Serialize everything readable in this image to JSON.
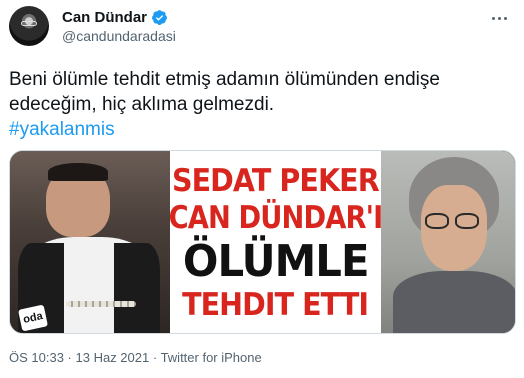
{
  "author": {
    "display_name": "Can Dündar",
    "handle": "@candundaradasi",
    "verified": true
  },
  "tweet": {
    "text_lines": [
      "Beni ölümle tehdit etmiş adamın ölümünden endişe",
      "edeceğim, hiç aklıma gelmezdi."
    ],
    "hashtag": "#yakalanmis"
  },
  "media": {
    "headline": [
      "SEDAT PEKER",
      "CAN DÜNDAR'I",
      "ÖLÜMLE",
      "TEHDIT ETTI"
    ],
    "logo_text": "oda"
  },
  "meta": {
    "time": "ÖS 10:33",
    "separator1": " · ",
    "date": "13 Haz 2021",
    "separator2": " · ",
    "source": "Twitter for iPhone"
  },
  "icons": {
    "verified": "verified-badge-icon",
    "more": "more-options-icon"
  },
  "colors": {
    "accent": "#1d9bf0",
    "text": "#0f1419",
    "secondary": "#536471",
    "headline_red": "#d8261f"
  }
}
